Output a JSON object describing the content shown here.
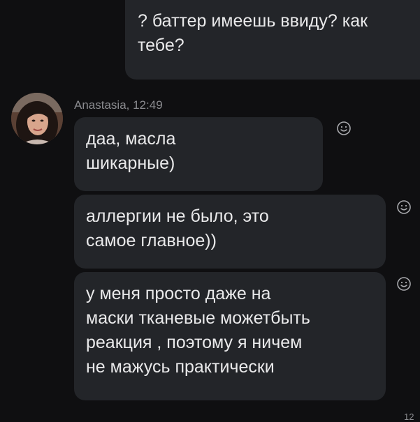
{
  "outgoing_message": {
    "lines": [
      "? баттер имеешь ввиду? как",
      "тебе?"
    ]
  },
  "incoming_group": {
    "sender_name": "Anastasia",
    "time": "12:49",
    "sender_line": "Anastasia, 12:49",
    "messages": [
      {
        "lines": [
          "даа, масла",
          "шикарные)"
        ]
      },
      {
        "lines": [
          "аллергии не было, это",
          "самое главное))"
        ]
      },
      {
        "lines": [
          "у меня просто даже на",
          "маски тканевые можетбыть",
          "реакция , поэтому я ничем",
          "не мажусь практически"
        ]
      }
    ]
  },
  "reaction_icon": "smiley-reaction-icon",
  "bottom_corner_text": "12",
  "colors": {
    "background": "#0f0f11",
    "bubble": "#232529",
    "text": "#e9e9ea",
    "meta": "#8a8b8f"
  }
}
